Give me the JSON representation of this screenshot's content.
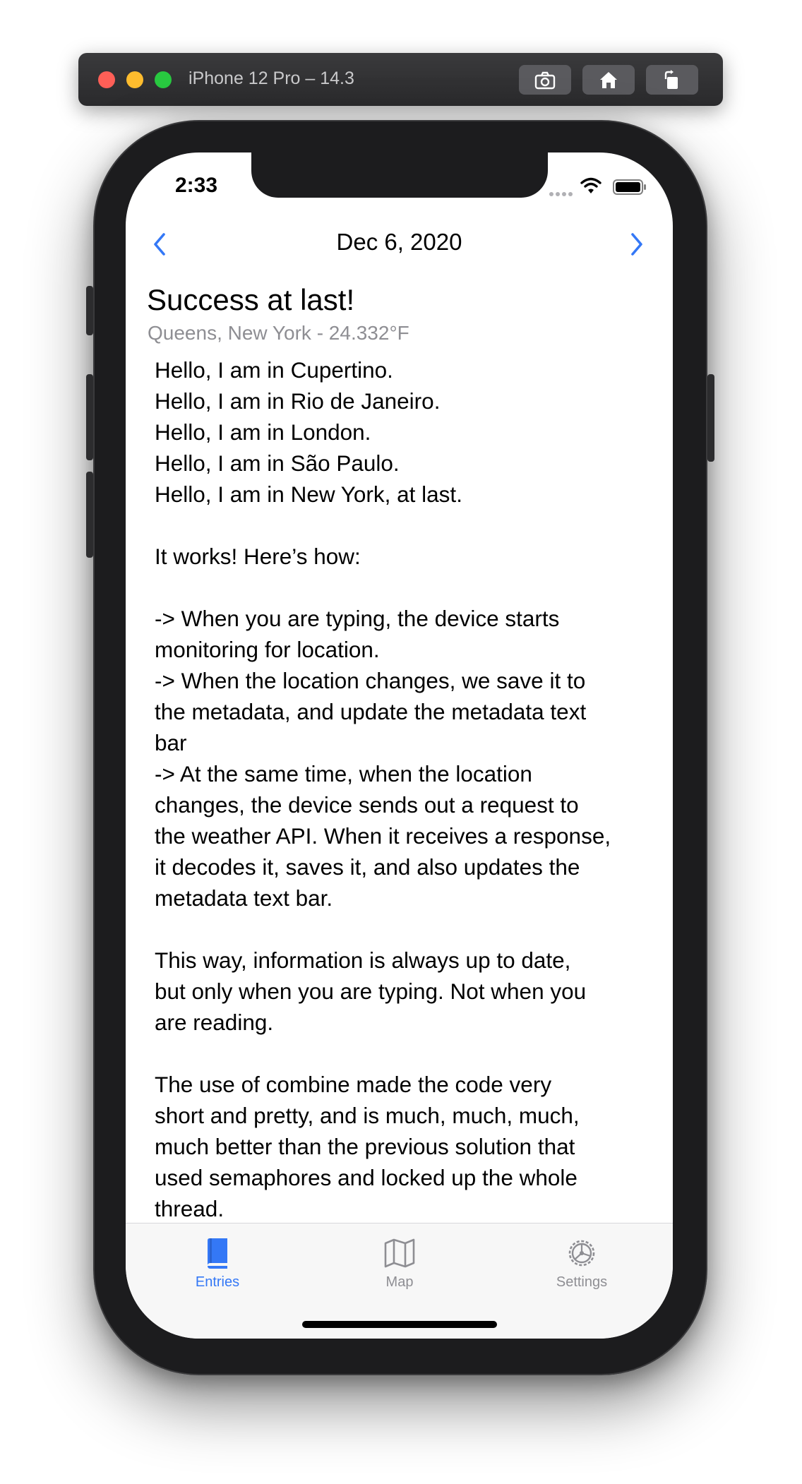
{
  "simulator": {
    "title": "iPhone 12 Pro – 14.3",
    "buttons": [
      "screenshot-icon",
      "home-icon",
      "rotate-icon"
    ]
  },
  "status_bar": {
    "time": "2:33"
  },
  "nav": {
    "title": "Dec 6, 2020",
    "prev_icon": "chevron-left-icon",
    "next_icon": "chevron-right-icon"
  },
  "entry": {
    "title": "Success at last!",
    "meta": "Queens, New York - 24.332°F",
    "body": "Hello, I am in Cupertino.\nHello, I am in Rio de Janeiro.\nHello, I am in London.\nHello, I am in São Paulo.\nHello, I am in New York, at last.\n\nIt works! Here’s how:\n\n-> When you are typing, the device starts\nmonitoring for location.\n-> When the location changes, we save it to\nthe metadata, and update the metadata text\nbar\n-> At the same time, when the location\nchanges, the device sends out a request to\nthe weather API. When it receives a response,\nit decodes it, saves it, and also updates the\nmetadata text bar.\n\nThis way, information is always up to date,\nbut only when you are typing. Not when you\nare reading.\n\nThe use of combine made the code very\nshort and pretty, and is much, much, much,\nmuch better than the previous solution that\nused semaphores and locked up the whole\nthread."
  },
  "tabs": [
    {
      "label": "Entries",
      "icon": "book-icon",
      "selected": true
    },
    {
      "label": "Map",
      "icon": "map-icon",
      "selected": false
    },
    {
      "label": "Settings",
      "icon": "gear-icon",
      "selected": false
    }
  ],
  "colors": {
    "accent": "#3478f6",
    "secondary_text": "#8e8e93"
  }
}
